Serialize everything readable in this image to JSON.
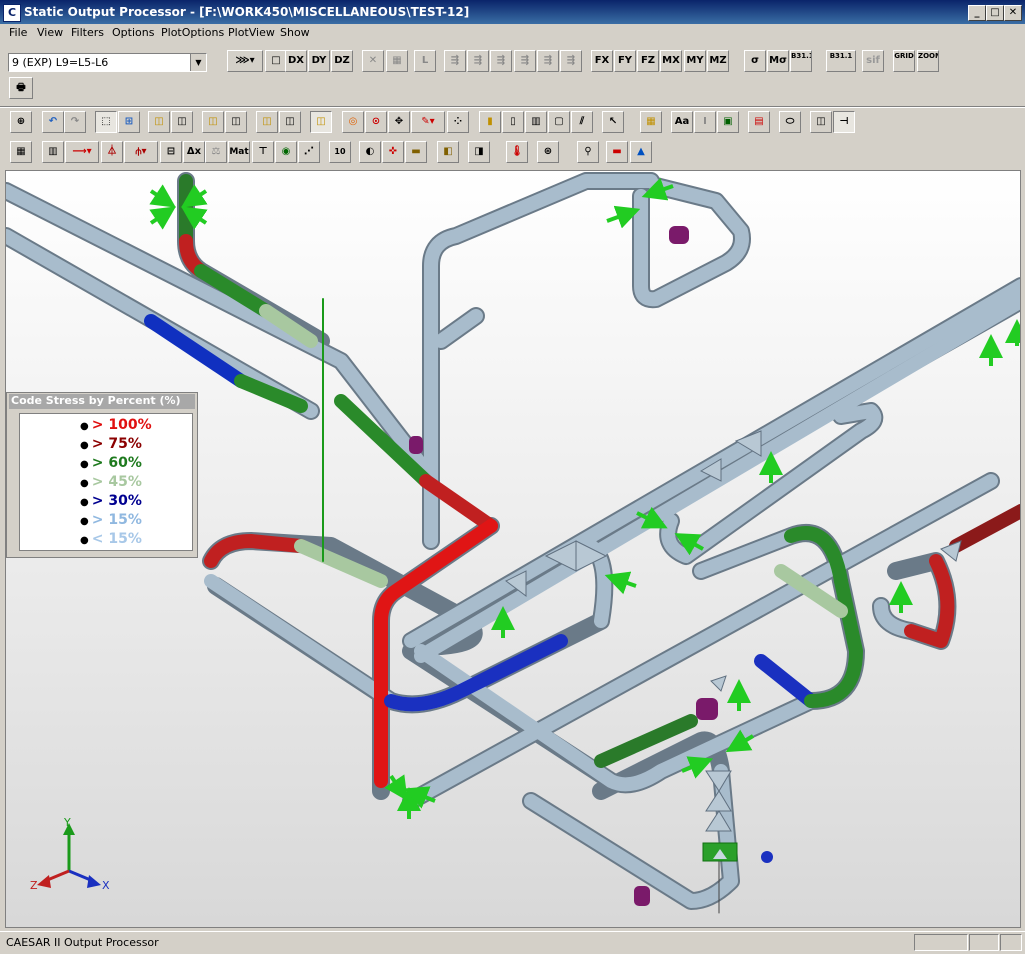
{
  "window": {
    "title": "Static Output Processor - [F:\\WORK450\\MISCELLANEOUS\\TEST-12]",
    "app_icon": "caesar-app-icon",
    "controls": {
      "minimize": "_",
      "restore": "□",
      "close": "✕"
    }
  },
  "menu": [
    "File",
    "View",
    "Filters",
    "Options",
    "PlotOptions",
    "PlotView",
    "Show"
  ],
  "load_case_select": {
    "value": "9 (EXP) L9=L5-L6"
  },
  "toolbar1": {
    "results": [
      "DX",
      "DY",
      "DZ",
      "FX",
      "FY",
      "FZ",
      "MX",
      "MY",
      "MZ"
    ],
    "stress_buttons": [
      "σ",
      "Mσ",
      "B31.1",
      "B31.1",
      "sif"
    ],
    "view_buttons": [
      "GRID",
      "ZOOM"
    ]
  },
  "toolbar3": {
    "dim_button": "Δx",
    "mat_button": "Mat",
    "ten_button": "10",
    "text_button": "Aa"
  },
  "legend": {
    "title": "Code Stress by Percent (%)",
    "items": [
      {
        "label": "> 100%",
        "color": "#e01010"
      },
      {
        "label": "> 75%",
        "color": "#8b0000"
      },
      {
        "label": "> 60%",
        "color": "#1e7a1e"
      },
      {
        "label": "> 45%",
        "color": "#a8c8a0"
      },
      {
        "label": "> 30%",
        "color": "#000090"
      },
      {
        "label": "> 15%",
        "color": "#90b8e0"
      },
      {
        "label": "< 15%",
        "color": "#a8c8e8"
      }
    ]
  },
  "axes": {
    "x": "X",
    "y": "Y",
    "z": "Z"
  },
  "status": {
    "text": "CAESAR II Output Processor"
  },
  "colors": {
    "pipe": "#a8bccc",
    "titlebar": "#0a246a",
    "support_arrow": "#22cc22",
    "hanger": "#7a1a6a"
  }
}
